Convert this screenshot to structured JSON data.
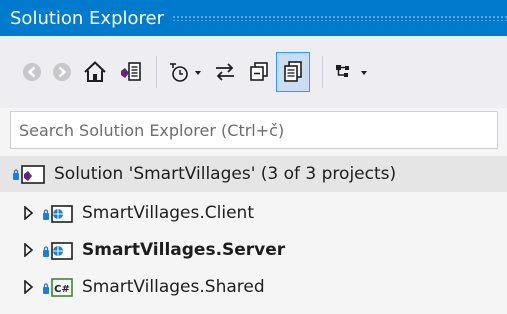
{
  "panel": {
    "title": "Solution Explorer"
  },
  "toolbar": {
    "buttons": [
      {
        "name": "back-button",
        "icon": "back-icon"
      },
      {
        "name": "forward-button",
        "icon": "forward-icon"
      },
      {
        "name": "home-button",
        "icon": "home-icon"
      },
      {
        "name": "switch-views-button",
        "icon": "switch-views-icon"
      },
      {
        "name": "pending-changes-filter-button",
        "icon": "clock-icon"
      },
      {
        "name": "sync-with-active-document-button",
        "icon": "sync-icon"
      },
      {
        "name": "collapse-all-button",
        "icon": "collapse-all-icon"
      },
      {
        "name": "show-all-files-button",
        "icon": "show-all-files-icon"
      },
      {
        "name": "properties-button",
        "icon": "hierarchy-icon"
      }
    ]
  },
  "search": {
    "placeholder": "Search Solution Explorer (Ctrl+č)"
  },
  "tree": {
    "solution": {
      "label": "Solution 'SmartVillages' (3 of 3 projects)",
      "icon": "solution-icon"
    },
    "projects": [
      {
        "label": "SmartVillages.Client",
        "icon": "web-project-icon",
        "bold": false
      },
      {
        "label": "SmartVillages.Server",
        "icon": "web-project-icon",
        "bold": true
      },
      {
        "label": "SmartVillages.Shared",
        "icon": "csharp-project-icon",
        "bold": false
      }
    ]
  },
  "colors": {
    "accent": "#007acc",
    "toolbar_bg": "#eeeef2",
    "selection_bg": "#e5e5e5",
    "visual_studio_purple": "#68217a",
    "csharp_green": "#388a34"
  }
}
